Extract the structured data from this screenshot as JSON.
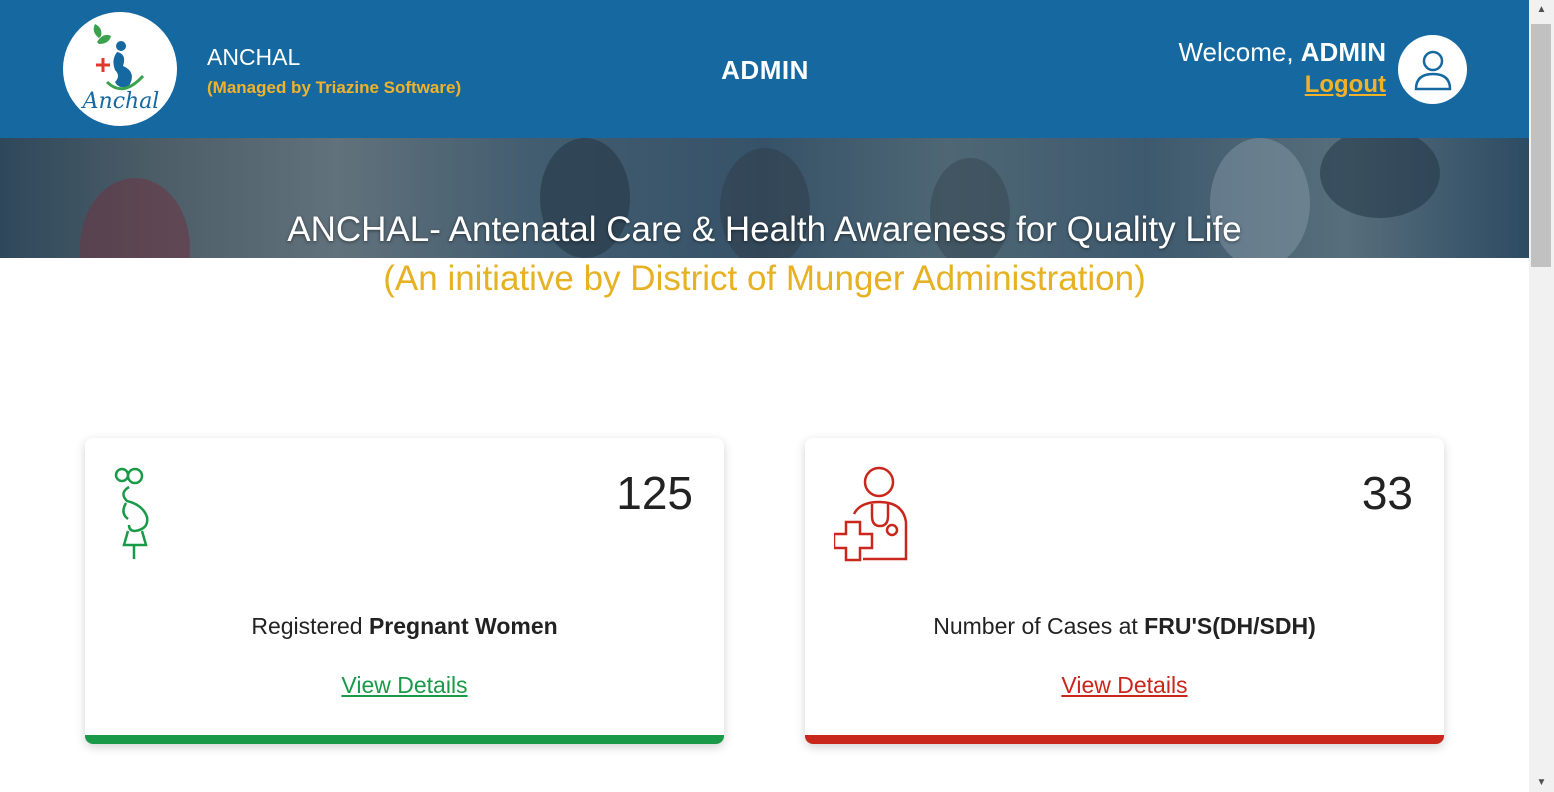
{
  "header": {
    "logo_text": "Anchal",
    "app_name": "ANCHAL",
    "managed_by": "(Managed by Triazine Software)",
    "role": "ADMIN",
    "welcome_prefix": "Welcome,",
    "username": "ADMIN",
    "logout": "Logout",
    "avatar_icon": "user-icon"
  },
  "hero": {
    "title": "ANCHAL- Antenatal Care & Health Awareness for Quality Life",
    "subtitle": "(An initiative by District of Munger Administration)"
  },
  "cards": [
    {
      "icon": "pregnant-woman-icon",
      "count": "125",
      "label_prefix": "Registered",
      "label_bold": "Pregnant Women",
      "link": "View Details",
      "color": "#1a9a48"
    },
    {
      "icon": "doctor-icon",
      "count": "33",
      "label_prefix": "Number of Cases at",
      "label_bold": "FRU'S(DH/SDH)",
      "link": "View Details",
      "color": "#c9261c"
    }
  ],
  "colors": {
    "header_bg": "#1569a0",
    "accent_yellow": "#f1b22a",
    "subtitle_yellow": "#e6b122"
  }
}
